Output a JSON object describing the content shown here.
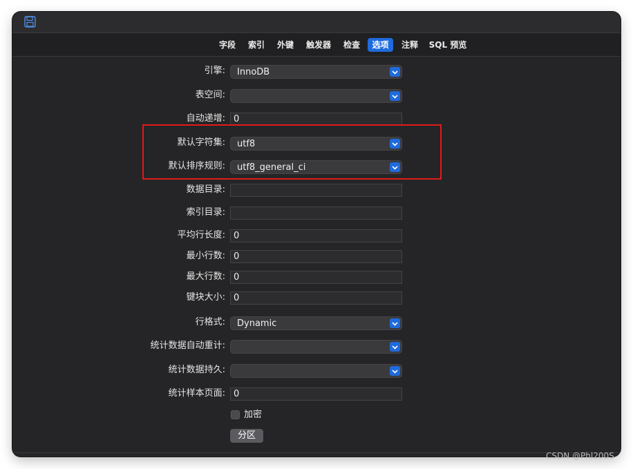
{
  "toolbar": {
    "icon": "save-icon"
  },
  "tabs": [
    {
      "label": "字段",
      "active": false
    },
    {
      "label": "索引",
      "active": false
    },
    {
      "label": "外键",
      "active": false
    },
    {
      "label": "触发器",
      "active": false
    },
    {
      "label": "检查",
      "active": false
    },
    {
      "label": "选项",
      "active": true
    },
    {
      "label": "注释",
      "active": false
    },
    {
      "label": "SQL 预览",
      "active": false
    }
  ],
  "options": {
    "engine": {
      "label": "引擎:",
      "value": "InnoDB"
    },
    "tablespace": {
      "label": "表空间:",
      "value": ""
    },
    "auto_increment": {
      "label": "自动递增:",
      "value": "0"
    },
    "charset": {
      "label": "默认字符集:",
      "value": "utf8"
    },
    "collation": {
      "label": "默认排序规则:",
      "value": "utf8_general_ci"
    },
    "data_dir": {
      "label": "数据目录:",
      "value": ""
    },
    "index_dir": {
      "label": "索引目录:",
      "value": ""
    },
    "avg_row_length": {
      "label": "平均行长度:",
      "value": "0"
    },
    "min_rows": {
      "label": "最小行数:",
      "value": "0"
    },
    "max_rows": {
      "label": "最大行数:",
      "value": "0"
    },
    "key_block_size": {
      "label": "键块大小:",
      "value": "0"
    },
    "row_format": {
      "label": "行格式:",
      "value": "Dynamic"
    },
    "stats_auto_recalc": {
      "label": "统计数据自动重计:",
      "value": ""
    },
    "stats_persistent": {
      "label": "统计数据持久:",
      "value": ""
    },
    "stats_sample_pages": {
      "label": "统计样本页面:",
      "value": "0"
    }
  },
  "encrypt": {
    "label": "加密",
    "checked": false
  },
  "partition_button": {
    "label": "分区"
  },
  "watermark": "CSDN @Phl200S",
  "colors": {
    "accent": "#1f6bdc",
    "highlight": "#e01b1b",
    "background": "#252527"
  }
}
